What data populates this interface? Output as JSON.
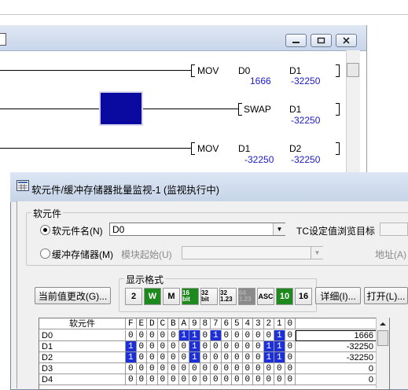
{
  "ladder": {
    "rungs": [
      {
        "instruction": "MOV",
        "op1": "D0",
        "op1_value": "1666",
        "op2": "D1",
        "op2_value": "-32250"
      },
      {
        "instruction": "SWAP",
        "op1": "D1",
        "op1_value": "-32250"
      },
      {
        "instruction": "MOV",
        "op1": "D1",
        "op1_value": "-32250",
        "op2": "D2",
        "op2_value": "-32250"
      }
    ]
  },
  "dialog": {
    "title": "软元件/缓冲存储器批量监视-1 (监视执行中)",
    "device_group_label": "软元件",
    "device_name_label": "软元件名(N)",
    "device_name_value": "D0",
    "tc_label": "TC设定值浏览目标",
    "buffer_label": "缓冲存储器(M)",
    "module_start_label": "模块起始(U)",
    "address_label": "地址(A)",
    "display_format_label": "显示格式",
    "current_value_button": "当前值更改(G)...",
    "format_buttons": [
      "2",
      "W",
      "M",
      "16 bit",
      "32 bit",
      "32 1.23",
      "64 1.23",
      "ASC",
      "10",
      "16"
    ],
    "detail_button": "详细(I)...",
    "open_button": "打开(L)...",
    "device_column_header": "软元件",
    "bit_headers": [
      "F",
      "E",
      "D",
      "C",
      "B",
      "A",
      "9",
      "8",
      "7",
      "6",
      "5",
      "4",
      "3",
      "2",
      "1",
      "0"
    ],
    "rows": [
      {
        "device": "D0",
        "bits": [
          0,
          0,
          0,
          0,
          0,
          1,
          1,
          0,
          1,
          0,
          0,
          0,
          0,
          0,
          1,
          0
        ],
        "value": "1666"
      },
      {
        "device": "D1",
        "bits": [
          1,
          0,
          0,
          0,
          0,
          0,
          1,
          0,
          0,
          0,
          0,
          0,
          0,
          1,
          1,
          0
        ],
        "value": "-32250"
      },
      {
        "device": "D2",
        "bits": [
          1,
          0,
          0,
          0,
          0,
          0,
          1,
          0,
          0,
          0,
          0,
          0,
          0,
          1,
          1,
          0
        ],
        "value": "-32250"
      },
      {
        "device": "D3",
        "bits": [
          0,
          0,
          0,
          0,
          0,
          0,
          0,
          0,
          0,
          0,
          0,
          0,
          0,
          0,
          0,
          0
        ],
        "value": "0"
      },
      {
        "device": "D4",
        "bits": [
          0,
          0,
          0,
          0,
          0,
          0,
          0,
          0,
          0,
          0,
          0,
          0,
          0,
          0,
          0,
          0
        ],
        "value": "0"
      }
    ]
  },
  "colors": {
    "bit_on": "#1c2fd8",
    "contact_fill": "#0a0aa0",
    "value_text": "#1a1acc",
    "green_button": "#1e8a1e"
  }
}
